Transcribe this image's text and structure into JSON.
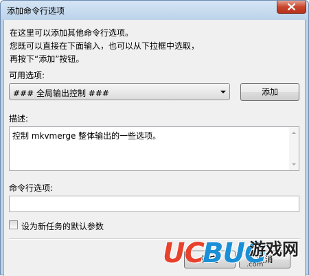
{
  "window": {
    "title": "添加命令行选项"
  },
  "intro": {
    "line1": "在这里可以添加其他命令行选项。",
    "line2": "您既可以直接在下面输入，也可以从下拉框中选取，",
    "line3": "再按下“添加”按钮。"
  },
  "available_options": {
    "label": "可用选项:",
    "selected": "### 全局输出控制 ###",
    "add_button": "添加"
  },
  "description": {
    "label": "描述:",
    "text": "控制 mkvmerge 整体输出的一些选项。"
  },
  "command_line": {
    "label": "命令行选项:",
    "value": ""
  },
  "default_checkbox": {
    "label": "设为新任务的默认参数",
    "checked": false
  },
  "footer": {
    "ok_label": "确定",
    "cancel_label": "取消"
  },
  "watermark": {
    "brand_a": "UC",
    "brand_b": "BUG",
    "site": "游戏网",
    "url": ".com"
  },
  "icons": {
    "close": "close-icon",
    "dropdown": "chevron-down-icon"
  },
  "colors": {
    "close_button": "#c9452c",
    "title_bar": "#bcd3ea",
    "watermark_red": "#e8412c",
    "watermark_blue": "#1a8fd6"
  }
}
